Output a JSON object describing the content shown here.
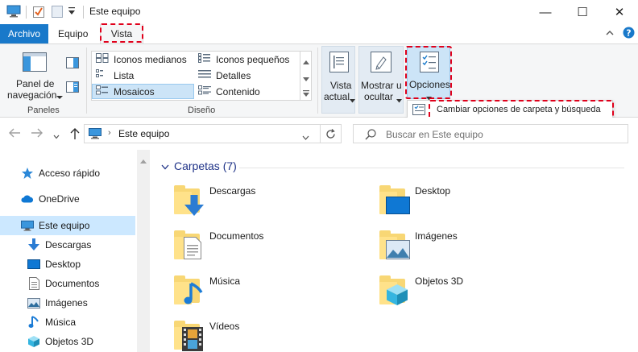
{
  "window": {
    "title": "Este equipo",
    "controls": {
      "minimize": "—",
      "maximize": "☐",
      "close": "✕"
    }
  },
  "ribbon": {
    "tabs": [
      {
        "label": "Archivo"
      },
      {
        "label": "Equipo"
      },
      {
        "label": "Vista",
        "highlighted": true
      }
    ],
    "panes": {
      "nav_line1": "Panel de",
      "nav_line2": "navegación",
      "group_label": "Paneles"
    },
    "layout": {
      "items": [
        {
          "label": "Iconos medianos"
        },
        {
          "label": "Iconos pequeños"
        },
        {
          "label": "Lista"
        },
        {
          "label": "Detalles"
        },
        {
          "label": "Mosaicos",
          "selected": true
        },
        {
          "label": "Contenido"
        }
      ],
      "group_label": "Diseño"
    },
    "view": {
      "current_line1": "Vista",
      "current_line2": "actual",
      "showhide_line1": "Mostrar u",
      "showhide_line2": "ocultar",
      "options_label": "Opciones",
      "options_menu_item": "Cambiar opciones de carpeta y búsqueda"
    },
    "accent_color": "#1979ca",
    "highlight_color": "#e0001b"
  },
  "address": {
    "path": "Este equipo",
    "search_placeholder": "Buscar en Este equipo"
  },
  "nav": {
    "items": [
      {
        "label": "Acceso rápido",
        "icon": "star-icon"
      },
      {
        "label": "OneDrive",
        "icon": "cloud-icon"
      },
      {
        "label": "Este equipo",
        "icon": "computer-icon",
        "selected": true
      },
      {
        "label": "Descargas",
        "icon": "download-icon"
      },
      {
        "label": "Desktop",
        "icon": "desktop-icon"
      },
      {
        "label": "Documentos",
        "icon": "document-icon"
      },
      {
        "label": "Imágenes",
        "icon": "image-icon"
      },
      {
        "label": "Música",
        "icon": "music-icon"
      },
      {
        "label": "Objetos 3D",
        "icon": "cube-icon"
      }
    ]
  },
  "content": {
    "group_title": "Carpetas (7)",
    "folders": [
      {
        "label": "Descargas",
        "icon": "download-folder-icon"
      },
      {
        "label": "Desktop",
        "icon": "desktop-folder-icon"
      },
      {
        "label": "Documentos",
        "icon": "documents-folder-icon"
      },
      {
        "label": "Imágenes",
        "icon": "pictures-folder-icon"
      },
      {
        "label": "Música",
        "icon": "music-folder-icon"
      },
      {
        "label": "Objetos 3D",
        "icon": "objects3d-folder-icon"
      },
      {
        "label": "Vídeos",
        "icon": "videos-folder-icon"
      }
    ]
  }
}
